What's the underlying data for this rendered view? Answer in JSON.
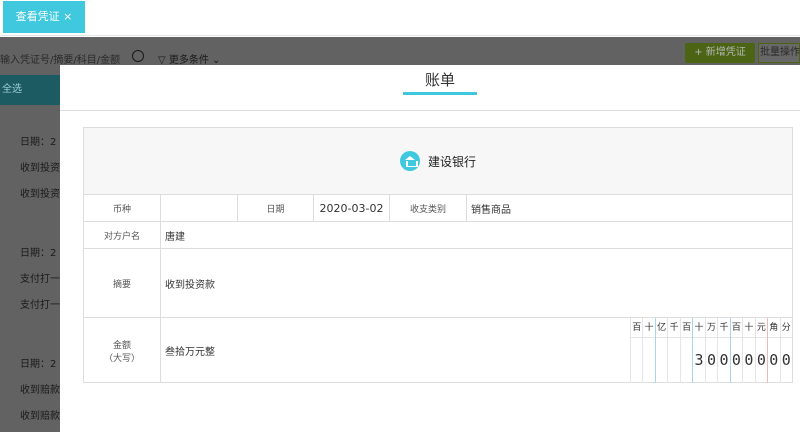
{
  "tab": {
    "label": "查看凭证",
    "close": "×"
  },
  "background": {
    "search_placeholder": "输入凭证号/摘要/科目/金额",
    "more_filters": "更多条件",
    "new_button": "+ 新增凭证",
    "batch_button": "批量操作",
    "select_all": "全选",
    "rows": [
      "日期：2",
      "收到投资",
      "收到投资",
      "日期：2",
      "支付打一",
      "支付打一",
      "日期：2",
      "收到赔款",
      "收到赔款"
    ]
  },
  "modal": {
    "title": "账单",
    "bank": "建设银行",
    "fields": {
      "currency_label": "币种",
      "currency": "",
      "date_label": "日期",
      "date": "2020-03-02",
      "category_label": "收支类别",
      "category": "销售商品",
      "counterparty_label": "对方户名",
      "counterparty": "唐建",
      "summary_label": "摘要",
      "summary": "收到投资款",
      "amount_label": "金额",
      "amount_label_sub": "（大写）",
      "amount_words": "叁拾万元整"
    },
    "digit_headers": [
      "百",
      "十",
      "亿",
      "千",
      "百",
      "十",
      "万",
      "千",
      "百",
      "十",
      "元",
      "角",
      "分"
    ],
    "digits": [
      "",
      "",
      "",
      "",
      "",
      "3",
      "0",
      "0",
      "0",
      "0",
      "0",
      "0",
      "0"
    ]
  },
  "colors": {
    "accent": "#3fc8de",
    "green": "#8bc34a"
  }
}
